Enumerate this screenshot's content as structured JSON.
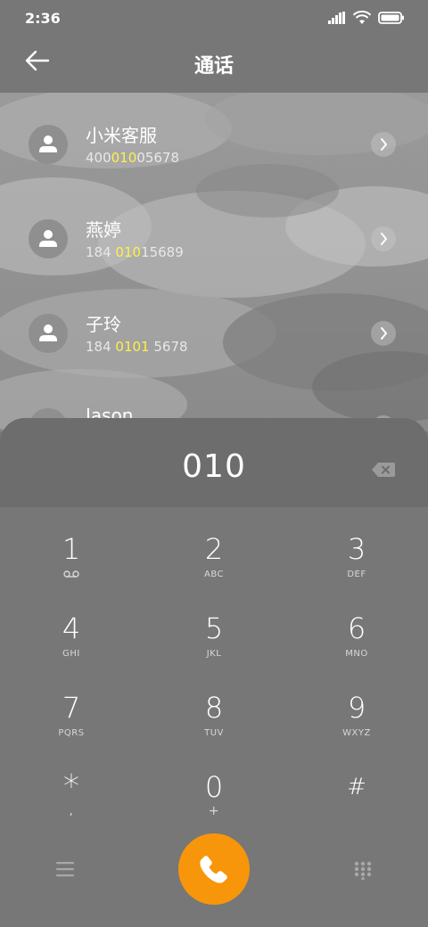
{
  "status_bar": {
    "time": "2:36",
    "icons": [
      "signal-icon",
      "wifi-icon",
      "battery-icon"
    ]
  },
  "header": {
    "title": "通话",
    "back_icon": "arrow-left-icon"
  },
  "contacts": [
    {
      "name": "小米客服",
      "number_pre": "400",
      "number_hl": "010",
      "number_post": "05678"
    },
    {
      "name": "燕婷",
      "number_pre": "184 ",
      "number_hl": "010",
      "number_post": "15689"
    },
    {
      "name": "子玲",
      "number_pre": "184 ",
      "number_hl": "0101",
      "number_post": " 5678"
    },
    {
      "name": "Jason",
      "number_pre": "",
      "number_hl": "",
      "number_post": ""
    }
  ],
  "dialer": {
    "input": "010",
    "keys": [
      {
        "num": "1",
        "sub": "voicemail-icon"
      },
      {
        "num": "2",
        "sub": "ABC"
      },
      {
        "num": "3",
        "sub": "DEF"
      },
      {
        "num": "4",
        "sub": "GHI"
      },
      {
        "num": "5",
        "sub": "JKL"
      },
      {
        "num": "6",
        "sub": "MNO"
      },
      {
        "num": "7",
        "sub": "PQRS"
      },
      {
        "num": "8",
        "sub": "TUV"
      },
      {
        "num": "9",
        "sub": "WXYZ"
      },
      {
        "num": "*",
        "sub": ","
      },
      {
        "num": "0",
        "sub": "+"
      },
      {
        "num": "#",
        "sub": ""
      }
    ]
  },
  "colors": {
    "call_button": "#f7960a",
    "highlight": "#fff04a",
    "panel": "#777777"
  }
}
